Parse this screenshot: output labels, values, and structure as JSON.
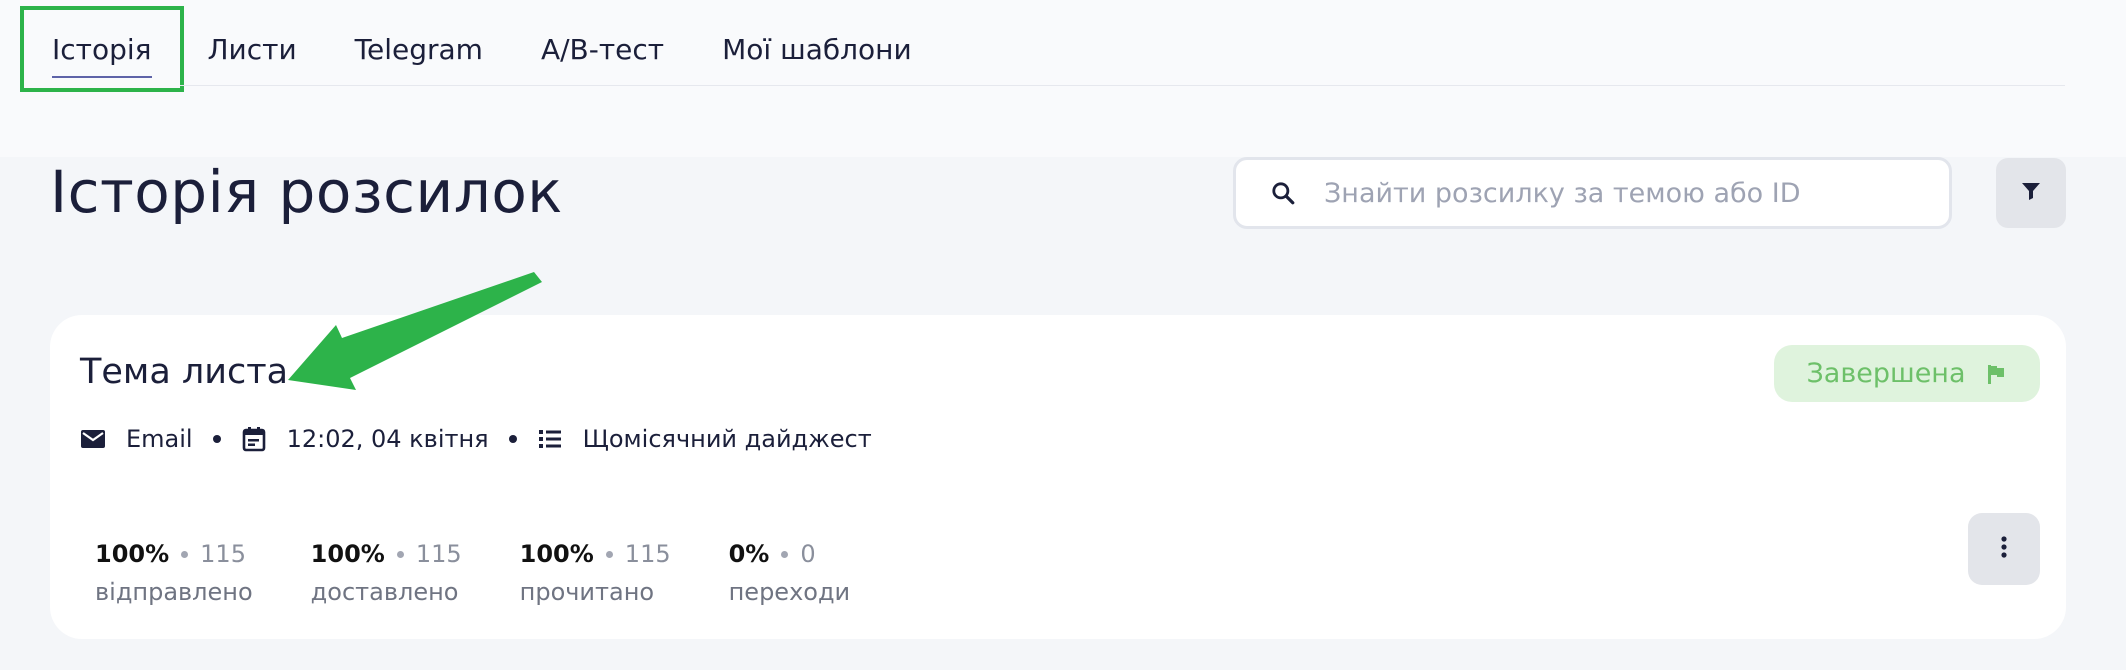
{
  "tabs": [
    {
      "label": "Історія",
      "active": true
    },
    {
      "label": "Листи"
    },
    {
      "label": "Telegram"
    },
    {
      "label": "A/B-тест"
    },
    {
      "label": "Мої шаблони"
    }
  ],
  "page": {
    "title": "Історія розсилок"
  },
  "search": {
    "placeholder": "Знайти розсилку за темою або ID",
    "value": "",
    "icon": "search-icon"
  },
  "filter": {
    "icon": "filter-icon"
  },
  "card": {
    "subject": "Тема листа",
    "status": {
      "label": "Завершена",
      "icon": "flag-icon",
      "color": "#6dc069"
    },
    "meta": {
      "channel": "Email",
      "datetime": "12:02, 04 квітня",
      "list": "Щомісячний дайджест"
    },
    "stats": [
      {
        "pct": "100%",
        "count": "115",
        "label": "відправлено"
      },
      {
        "pct": "100%",
        "count": "115",
        "label": "доставлено"
      },
      {
        "pct": "100%",
        "count": "115",
        "label": "прочитано"
      },
      {
        "pct": "0%",
        "count": "0",
        "label": "переходи"
      }
    ],
    "more_icon": "more-vertical-icon"
  },
  "colors": {
    "accent_green": "#2db34a",
    "tab_underline": "#5e63a8"
  }
}
